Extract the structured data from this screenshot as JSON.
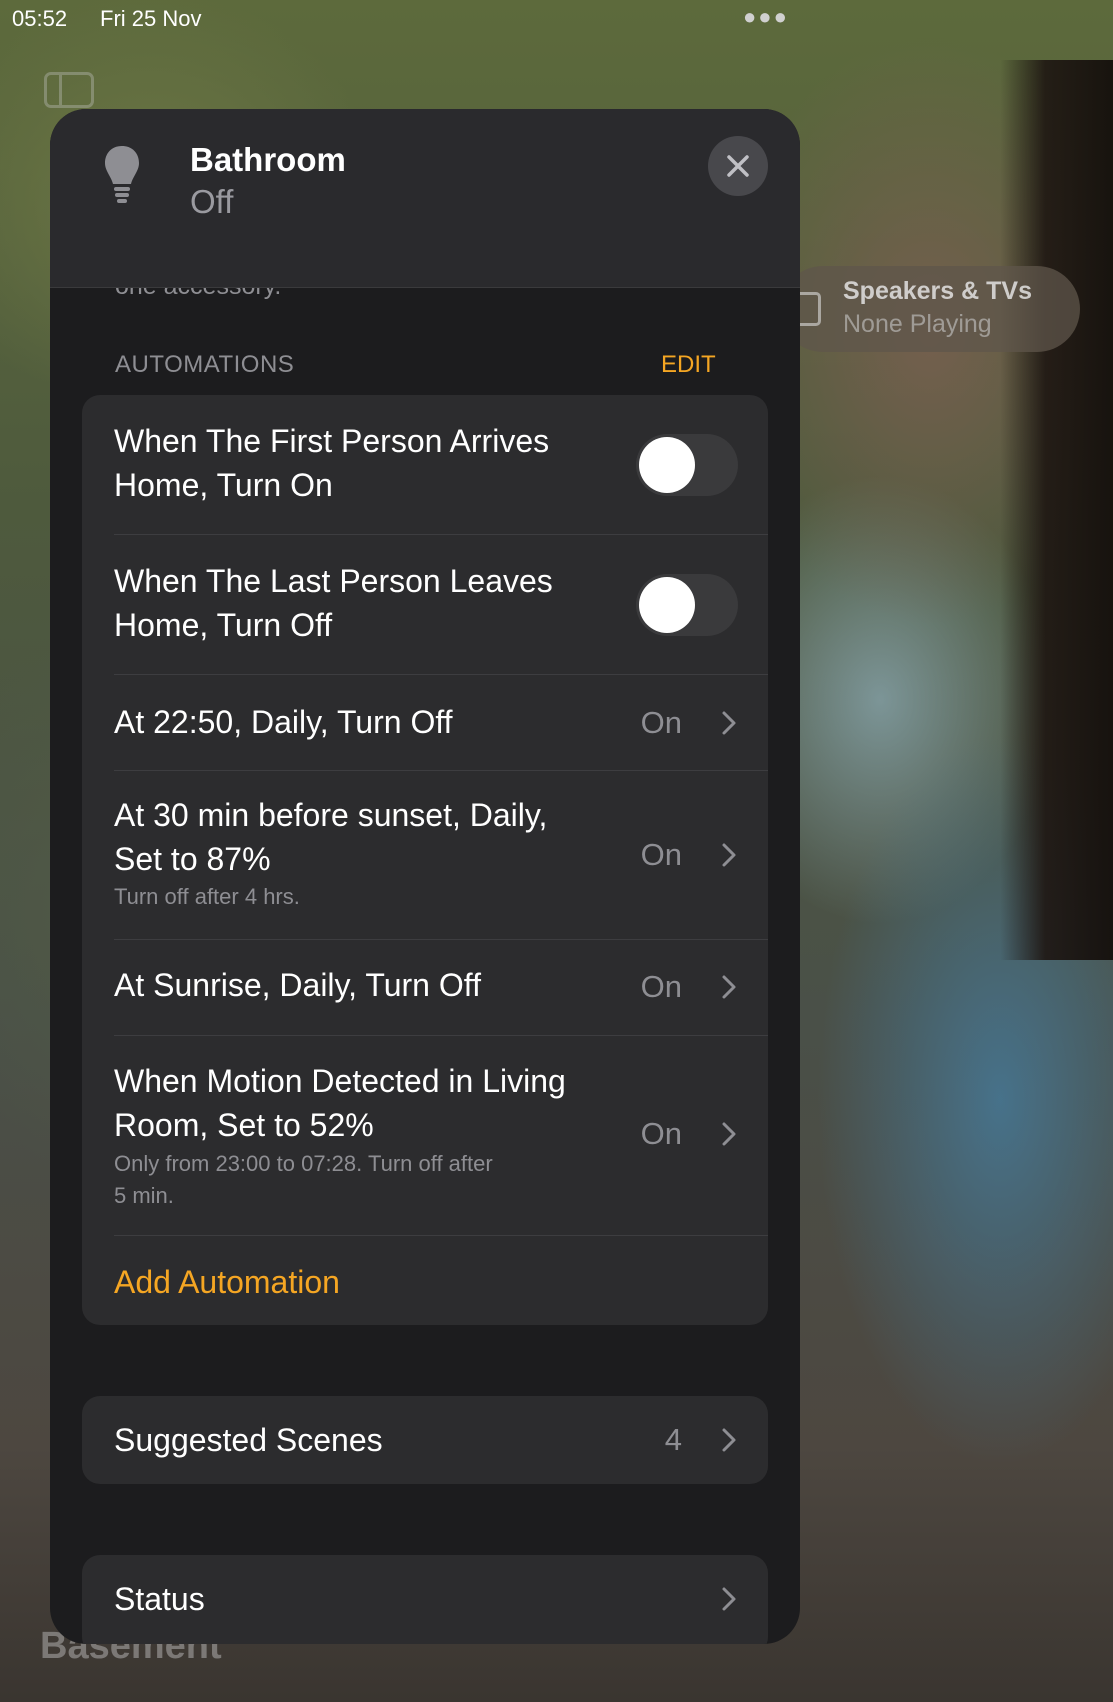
{
  "status_bar": {
    "time": "05:52",
    "date": "Fri 25 Nov",
    "more_icon": "ellipsis-icon"
  },
  "background": {
    "speakers": {
      "title": "Speakers & TVs",
      "subtitle": "None Playing"
    },
    "section_label": "Basement"
  },
  "accessory": {
    "name": "Bathroom",
    "state": "Off",
    "icon": "lightbulb-icon"
  },
  "cutoff_text": "one accessory.",
  "automations": {
    "header": "AUTOMATIONS",
    "edit_label": "EDIT",
    "items": [
      {
        "title_line1": "When The First Person Arrives",
        "title_line2": "Home, Turn On",
        "type": "toggle",
        "enabled": false
      },
      {
        "title_line1": "When The Last Person Leaves",
        "title_line2": "Home, Turn Off",
        "type": "toggle",
        "enabled": false
      },
      {
        "title_line1": "At 22:50, Daily, Turn Off",
        "value": "On",
        "type": "link"
      },
      {
        "title_line1": "At 30 min before sunset, Daily,",
        "title_line2": "Set to 87%",
        "subtitle_line1": "Turn off after 4 hrs.",
        "value": "On",
        "type": "link"
      },
      {
        "title_line1": "At Sunrise, Daily, Turn Off",
        "value": "On",
        "type": "link"
      },
      {
        "title_line1": "When Motion Detected in Living",
        "title_line2": "Room, Set to 52%",
        "subtitle_line1": "Only from 23:00 to 07:28. Turn off after",
        "subtitle_line2": "5 min.",
        "value": "On",
        "type": "link"
      }
    ],
    "add_label": "Add Automation"
  },
  "suggested_scenes": {
    "label": "Suggested Scenes",
    "count": "4"
  },
  "status_row": {
    "label": "Status"
  },
  "colors": {
    "accent": "#f5a623",
    "card": "#1c1c1e",
    "group": "#2c2c2e"
  }
}
